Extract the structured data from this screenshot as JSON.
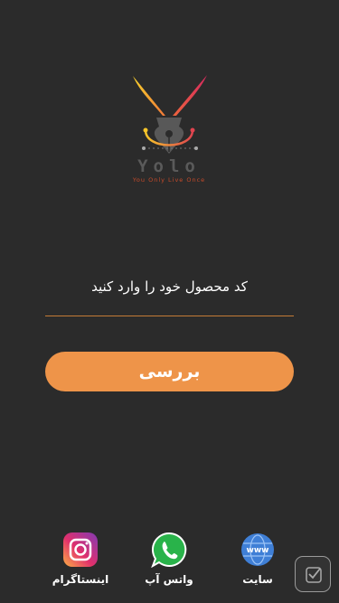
{
  "logo": {
    "name": "Yolo",
    "tagline": "You Only Live Once"
  },
  "form": {
    "label": "کد محصول خود را وارد کنید",
    "value": "",
    "button_label": "بررسی"
  },
  "social": [
    {
      "id": "instagram",
      "label": "اینستاگرام"
    },
    {
      "id": "whatsapp",
      "label": "واتس آپ"
    },
    {
      "id": "website",
      "label": "سایت",
      "icon_text": "www"
    }
  ],
  "colors": {
    "background": "#2b2b2b",
    "accent": "#ee9449",
    "underline": "#c47a35"
  }
}
